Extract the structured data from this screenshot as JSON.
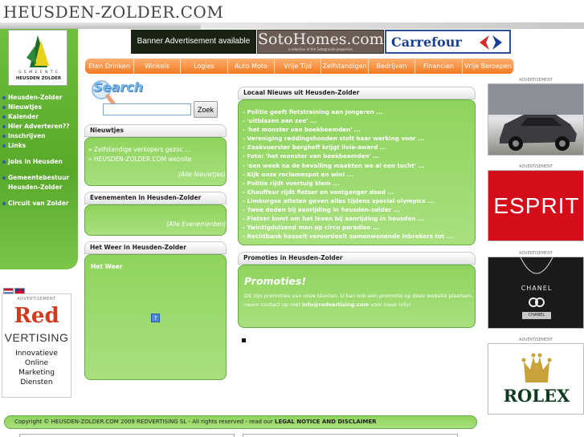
{
  "site": {
    "title": "HEUSDEN-ZOLDER.COM"
  },
  "logo": {
    "line1": "G E M E E N T E",
    "line2": "HEUSDEN ZOLDER"
  },
  "banners": {
    "text_banner": "Banner Advertisement available",
    "soto_main": "SotoHomes.com",
    "soto_sub": "a selection of the Sotogrande properties",
    "carrefour": "Carrefour"
  },
  "topnav": [
    "Eten Drinken",
    "Winkels",
    "Logies",
    "Auto Moto",
    "Vrije Tijd",
    "Zelfstandigen",
    "Bedrijven",
    "Financien",
    "Vrije Beroepen"
  ],
  "sidebar": {
    "items": [
      "Heusden-Zolder",
      "Nieuwtjes",
      "Kalender",
      "Hier Adverteren??",
      "Inschrijven",
      "Links"
    ],
    "items2": [
      "Jobs in Heusden"
    ],
    "items3": [
      "Gemeentebestuur",
      "Heusden-Zolder"
    ],
    "items4": [
      "Circuit van Zolder"
    ]
  },
  "search": {
    "label": "Search",
    "button": "Zoek",
    "value": ""
  },
  "nieuwtjes": {
    "title": "Nieuwtjes",
    "items": [
      "» Zelfstandige verkopers gezoc ...",
      "» HEUSDEN-ZOLDER.COM website"
    ],
    "all_link": "(Alle Nieuwtjes)"
  },
  "evenementen": {
    "title": "Evenementen in Heusden-Zolder",
    "all_link": "(Alle Evenementen)"
  },
  "weer": {
    "title": "Het Weer in Heusden-Zolder",
    "label": "Het Weer",
    "icon": "?"
  },
  "local_news": {
    "title": "Locaal Nieuws uit Heusden-Zolder",
    "items": [
      "- Politie geeft fietstraining aan jongeren ...",
      "- 'uitblazen aan zee' ...",
      "- 'het monster van beekbeemden' ...",
      "- Vereniging reddingshonden stelt haar werking voor ...",
      "- Zaakvoerster berghoff krijgt livia-award ...",
      "- Foto: 'het monster van beekbeemden' ...",
      "- 'een week na de bevalling maakten we al een tocht' ...",
      "- Kijk onze reclamespot en win! ...",
      "- Politie rijdt voertuig klem ...",
      "- Chauffeur rijdt fietser en voetganger dood ...",
      "- Limburgse atleten geven alles tijdens special olympics ...",
      "- Twee doden bij aanrijding in heusden-zolder ...",
      "- Fietser komt om het leven bij aanrijding in heusden ...",
      "- Twintigduizend man op circo paradiso ...",
      "- Rechtbank hasselt veroordeelt samenwonende inbrekers tot ..."
    ]
  },
  "promoties": {
    "title": "Promoties in Heusden-Zolder",
    "heading": "Promoties!",
    "text_before": "Dit zijn promoties van onze klanten. U kan ook een promotie op deze website plaatsen, neem contact op met ",
    "email": "info@redvertising.com",
    "text_after": " voor meer info!"
  },
  "left_ad": {
    "label": "ADVERTISEMENT",
    "word1": "Red",
    "word2": "VERTISING",
    "lines": [
      "Innovatieve",
      "Online",
      "Marketing",
      "Diensten"
    ]
  },
  "right_ads": {
    "label": "ADVERTISEMENT",
    "esprit": "ESPRIT",
    "chanel": "CHANEL",
    "chanel_tag": "CHANEL",
    "rolex": "ROLEX"
  },
  "footer": {
    "text": "Copyright © HEUSDEN-ZOLDER.COM 2009 REDVERTISING SL - All rights reserved - read our ",
    "link": "LEGAL NOTICE AND DISCLAIMER"
  },
  "colors": {
    "green": "#8fd45e",
    "orange": "#f07a22",
    "navy": "#1a3f8f",
    "esprit_red": "#d40d1a"
  },
  "icons": {
    "search": "magnifier-icon",
    "bullet": "dot-icon",
    "flags": [
      "dutch-flag-icon",
      "uk-flag-icon"
    ]
  }
}
